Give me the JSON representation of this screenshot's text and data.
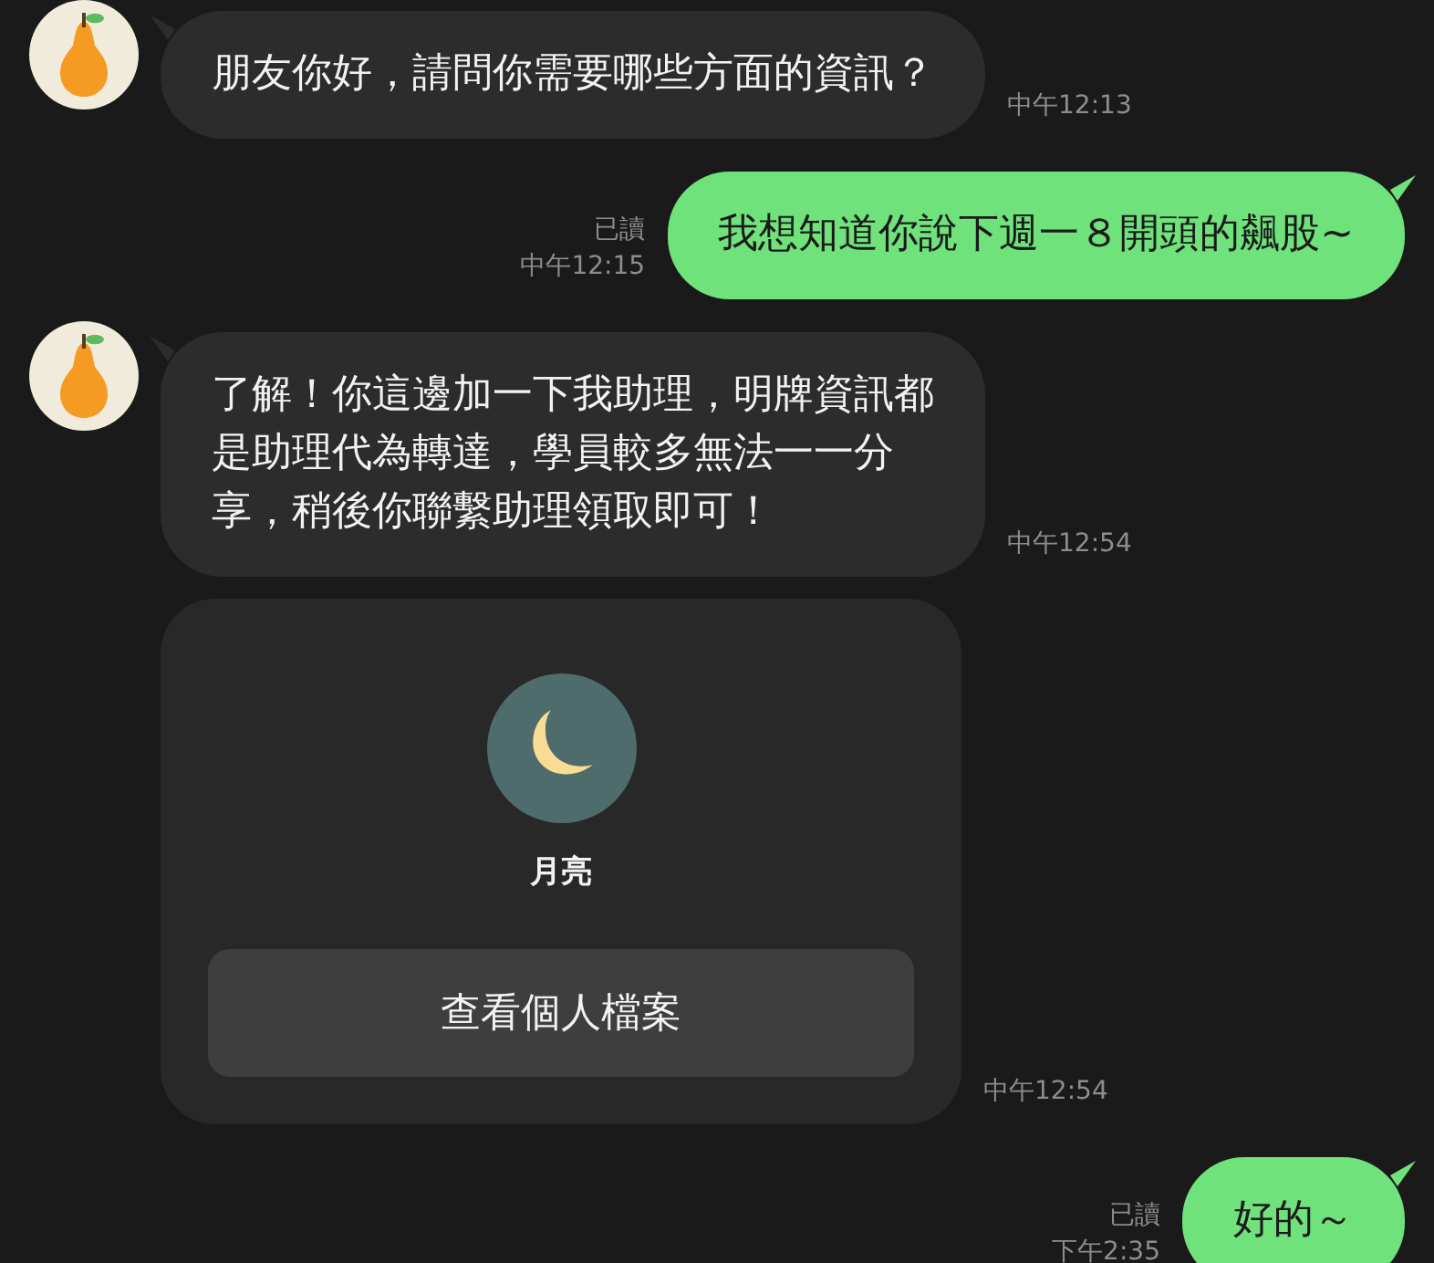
{
  "messages": [
    {
      "kind": "text",
      "outgoing": false,
      "avatar": true,
      "lines": [
        "朋友你好，請問你需要哪些方面的資訊？"
      ],
      "time": "中午12:13"
    },
    {
      "kind": "text",
      "outgoing": true,
      "lines": [
        "我想知道你說下週一８開頭的飆股~"
      ],
      "read": "已讀",
      "time": "中午12:15"
    },
    {
      "kind": "text",
      "outgoing": false,
      "avatar": true,
      "lines": [
        "了解！你這邊加一下我助理，明牌資訊都",
        "是助理代為轉達，學員較多無法一一分",
        "享，稍後你聯繫助理領取即可！"
      ],
      "time": "中午12:54"
    },
    {
      "kind": "profile_card",
      "outgoing": false,
      "avatar": false,
      "name": "月亮",
      "button": "查看個人檔案",
      "time": "中午12:54"
    },
    {
      "kind": "text",
      "outgoing": true,
      "lines": [
        "好的～"
      ],
      "read": "已讀",
      "time": "下午2:35"
    }
  ]
}
